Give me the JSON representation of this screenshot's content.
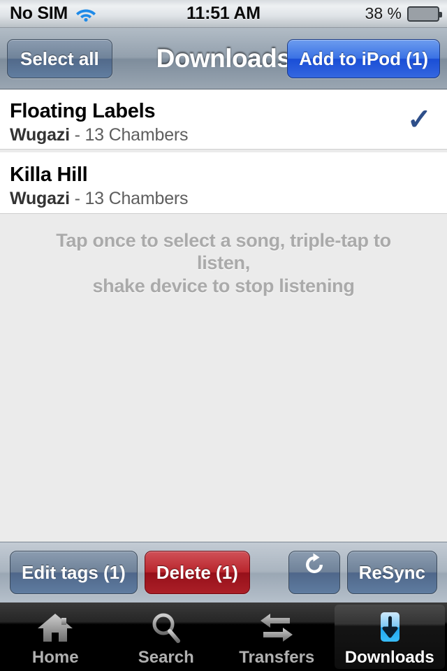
{
  "statusbar": {
    "carrier": "No SIM",
    "wifi_icon": "wifi-icon",
    "time": "11:51 AM",
    "battery_text": "38 %",
    "battery_percent": 38,
    "battery_fill_color": "#6fcc22"
  },
  "navbar": {
    "left_button": "Select all",
    "title": "Downloads",
    "right_button": "Add to iPod (1)",
    "right_button_color": "#2a5fdd"
  },
  "list": {
    "rows": [
      {
        "title": "Floating Labels",
        "artist": "Wugazi",
        "separator": " - ",
        "album": "13 Chambers",
        "selected": true,
        "check_glyph": "✓"
      },
      {
        "title": "Killa Hill",
        "artist": "Wugazi",
        "separator": " - ",
        "album": "13 Chambers",
        "selected": false,
        "check_glyph": ""
      }
    ],
    "hint_line1": "Tap once to select a song, triple-tap to listen,",
    "hint_line2": "shake device to stop listening"
  },
  "toolbar": {
    "edit_tags": "Edit tags (1)",
    "delete": "Delete (1)",
    "delete_color": "#b02029",
    "refresh_icon": "refresh-icon",
    "refresh_glyph": "⟳",
    "resync": "ReSync"
  },
  "tabbar": {
    "tabs": [
      {
        "label": "Home",
        "icon": "home-icon",
        "active": false
      },
      {
        "label": "Search",
        "icon": "search-icon",
        "active": false
      },
      {
        "label": "Transfers",
        "icon": "transfers-icon",
        "active": false
      },
      {
        "label": "Downloads",
        "icon": "download-icon",
        "active": true
      }
    ]
  }
}
